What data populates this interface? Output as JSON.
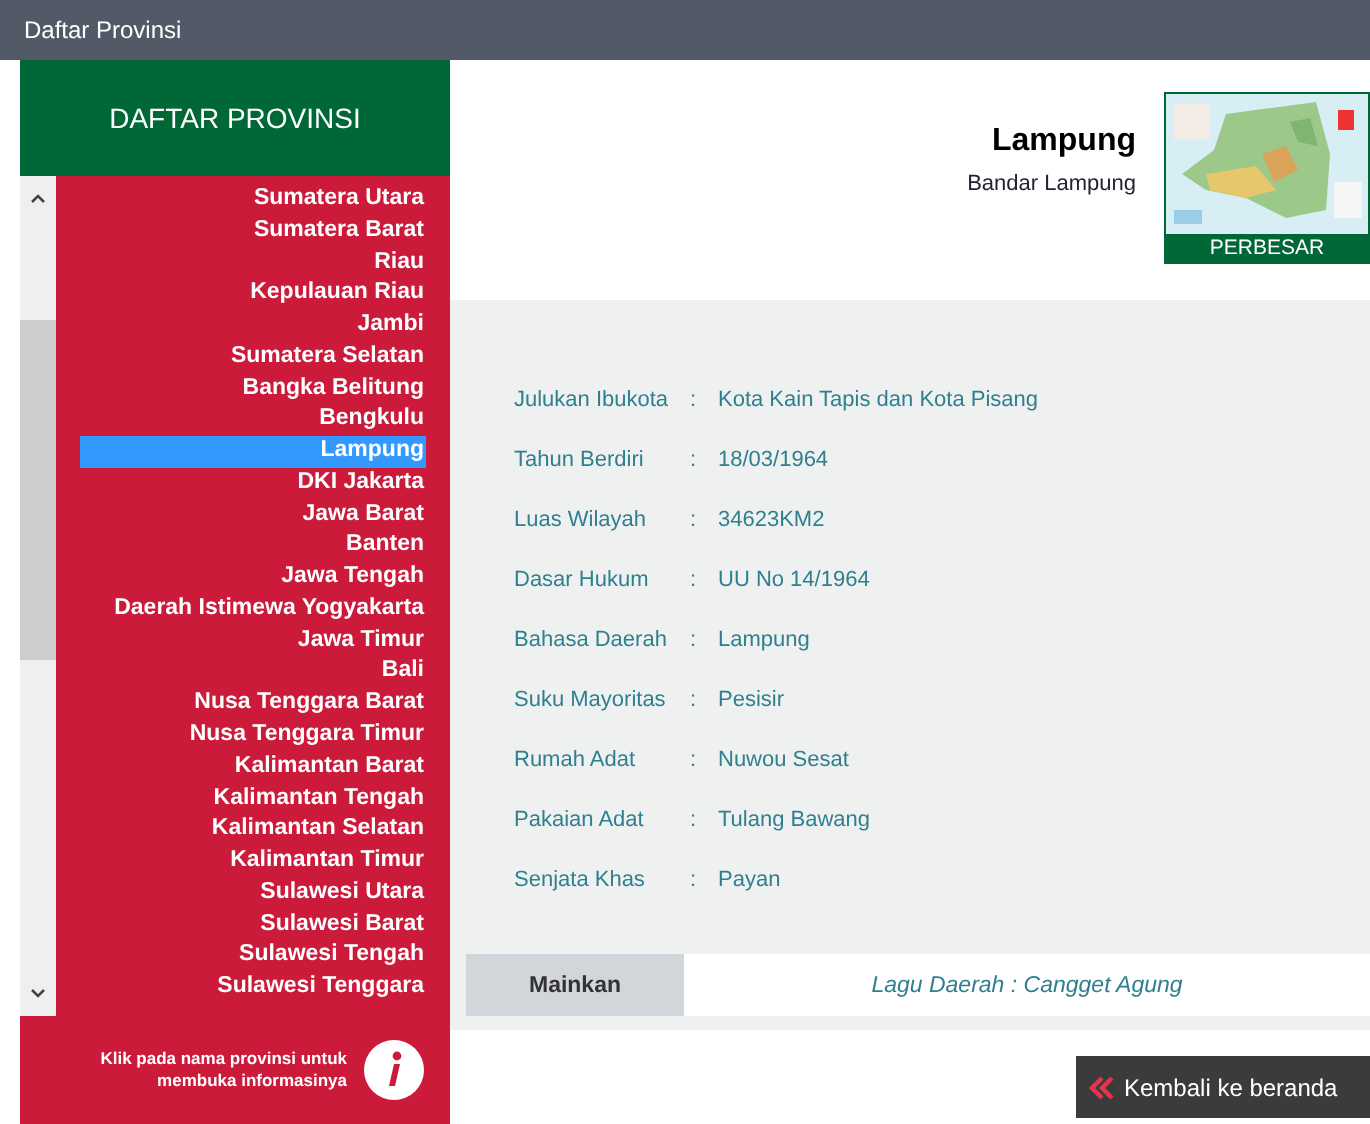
{
  "window": {
    "title": "Daftar Provinsi"
  },
  "sidebar": {
    "title": "DAFTAR PROVINSI",
    "items": [
      {
        "label": "Sumatera Utara",
        "selected": false
      },
      {
        "label": "Sumatera Barat",
        "selected": false
      },
      {
        "label": "Riau",
        "selected": false
      },
      {
        "label": "Kepulauan Riau",
        "selected": false
      },
      {
        "label": "Jambi",
        "selected": false
      },
      {
        "label": "Sumatera Selatan",
        "selected": false
      },
      {
        "label": "Bangka Belitung",
        "selected": false
      },
      {
        "label": "Bengkulu",
        "selected": false
      },
      {
        "label": "Lampung",
        "selected": true
      },
      {
        "label": "DKI Jakarta",
        "selected": false
      },
      {
        "label": "Jawa Barat",
        "selected": false
      },
      {
        "label": "Banten",
        "selected": false
      },
      {
        "label": "Jawa Tengah",
        "selected": false
      },
      {
        "label": "Daerah Istimewa Yogyakarta",
        "selected": false
      },
      {
        "label": "Jawa Timur",
        "selected": false
      },
      {
        "label": "Bali",
        "selected": false
      },
      {
        "label": "Nusa Tenggara Barat",
        "selected": false
      },
      {
        "label": "Nusa Tenggara Timur",
        "selected": false
      },
      {
        "label": "Kalimantan Barat",
        "selected": false
      },
      {
        "label": "Kalimantan Tengah",
        "selected": false
      },
      {
        "label": "Kalimantan Selatan",
        "selected": false
      },
      {
        "label": "Kalimantan Timur",
        "selected": false
      },
      {
        "label": "Sulawesi Utara",
        "selected": false
      },
      {
        "label": "Sulawesi Barat",
        "selected": false
      },
      {
        "label": "Sulawesi Tengah",
        "selected": false
      },
      {
        "label": "Sulawesi Tenggara",
        "selected": false
      }
    ],
    "hint": "Klik pada nama provinsi untuk membuka informasinya"
  },
  "province": {
    "name": "Lampung",
    "capital": "Bandar Lampung",
    "map": {
      "kind": "picture",
      "button": "PERBESAR"
    }
  },
  "details": [
    {
      "label": "Julukan Ibukota",
      "value": "Kota Kain Tapis dan Kota Pisang"
    },
    {
      "label": "Tahun Berdiri",
      "value": "18/03/1964"
    },
    {
      "label": "Luas Wilayah",
      "value": "34623KM2"
    },
    {
      "label": "Dasar Hukum",
      "value": "UU No 14/1964"
    },
    {
      "label": "Bahasa Daerah",
      "value": "Lampung"
    },
    {
      "label": "Suku Mayoritas",
      "value": "Pesisir"
    },
    {
      "label": "Rumah Adat",
      "value": "Nuwou Sesat"
    },
    {
      "label": "Pakaian Adat",
      "value": "Tulang Bawang"
    },
    {
      "label": "Senjata Khas",
      "value": "Payan"
    }
  ],
  "separator": ":",
  "song": {
    "button": "Mainkan",
    "title": "Lagu Daerah : Cangget Agung"
  },
  "back_button": "Kembali ke beranda"
}
